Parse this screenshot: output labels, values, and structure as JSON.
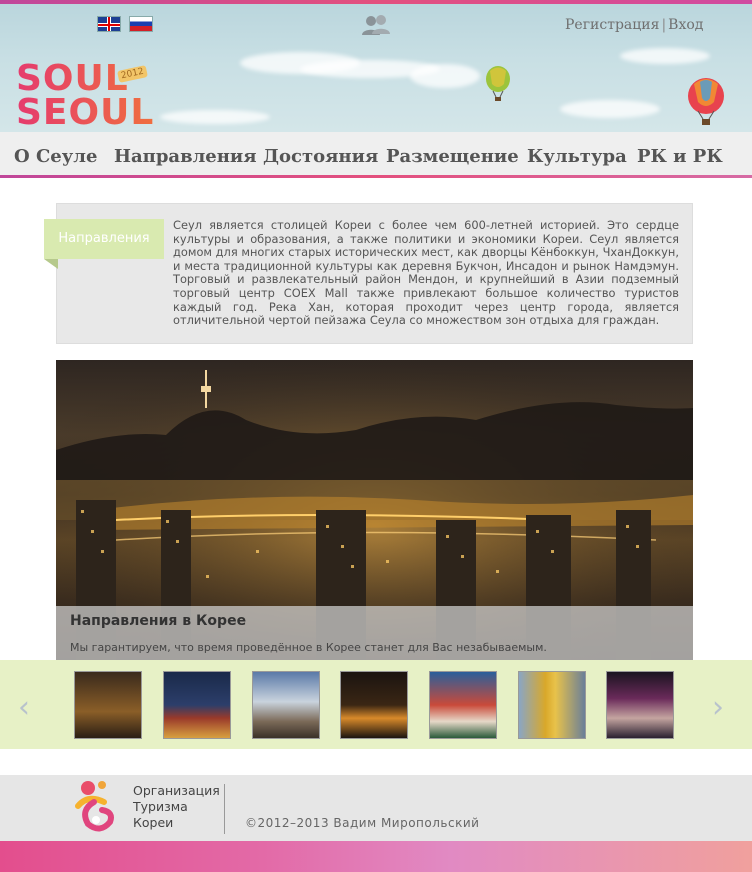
{
  "header": {
    "languages": [
      {
        "name": "flag-uk-icon",
        "code": "en"
      },
      {
        "name": "flag-ru-icon",
        "code": "ru"
      }
    ],
    "users_icon": "users-icon",
    "register_label": "Регистрация",
    "separator": "|",
    "login_label": "Вход",
    "logo": {
      "line1": "SOUL",
      "line2": "SEOUL",
      "badge": "2012"
    },
    "colors": {
      "accent_pink": "#e3507e",
      "nav_bg": "#efefef"
    }
  },
  "nav": {
    "items": [
      {
        "label": "О Сеуле"
      },
      {
        "label": "Направления"
      },
      {
        "label": "Достояния"
      },
      {
        "label": "Размещение"
      },
      {
        "label": "Культура"
      },
      {
        "label": "РК и РК"
      }
    ]
  },
  "intro": {
    "label": "Направления",
    "text": "Сеул является столицей Кореи с более чем 600-летней историей. Это сердце культуры и образования, а также политики и экономики Кореи. Сеул является домом для многих старых исторических мест, как дворцы Кёнбоккун, ЧханДоккун, и места традиционной культуры как деревня Букчон, Инсадон и рынок Намдэмун. Торговый и развлекательный район Мендон, и крупнейший в Азии подземный торговый центр COEX Mall также привлекают большое количество туристов каждый год. Река Хан, которая проходит через центр города, является отличительной чертой пейзажа Сеула со множеством зон отдыха для граждан."
  },
  "hero": {
    "title": "Направления в Корее",
    "subtitle": "Мы гарантируем, что время проведённое в Корее станет для Вас незабываемым."
  },
  "gallery": {
    "prev_label": "‹",
    "next_label": "›",
    "thumbs": [
      {
        "name": "thumb-night-city"
      },
      {
        "name": "thumb-tower"
      },
      {
        "name": "thumb-village"
      },
      {
        "name": "thumb-lanterns"
      },
      {
        "name": "thumb-guards"
      },
      {
        "name": "thumb-skyscraper"
      },
      {
        "name": "thumb-street"
      }
    ]
  },
  "footer": {
    "org_line1": "Организация",
    "org_line2": "Туризма",
    "org_line3": "Кореи",
    "copyright": "©2012–2013 Вадим Миропольский"
  }
}
